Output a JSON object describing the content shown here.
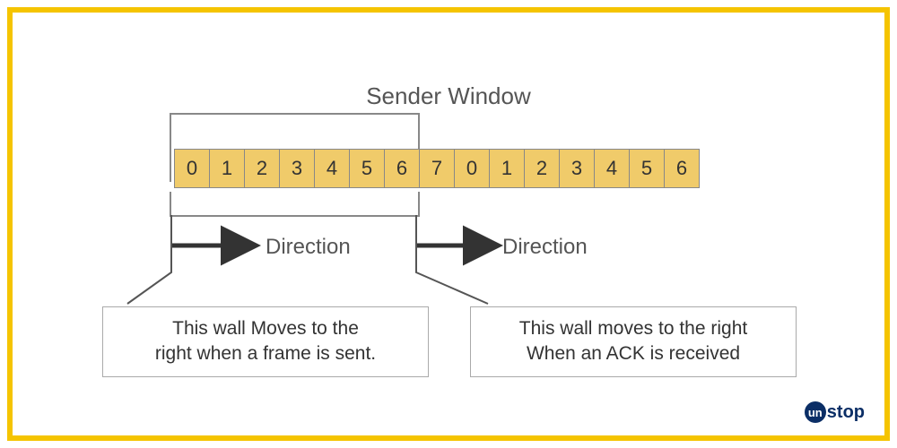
{
  "title": "Sender Window",
  "cells": [
    "0",
    "1",
    "2",
    "3",
    "4",
    "5",
    "6",
    "7",
    "0",
    "1",
    "2",
    "3",
    "4",
    "5",
    "6"
  ],
  "direction_label_1": "Direction",
  "direction_label_2": "Direction",
  "note_left_line1": "This wall Moves to the",
  "note_left_line2": "right when a frame is sent.",
  "note_right_line1": "This wall moves to the right",
  "note_right_line2": "When an ACK is received",
  "logo_badge": "un",
  "logo_text": "stop",
  "colors": {
    "accent": "#f5c400",
    "cell": "#f0cb6a",
    "ink": "#333",
    "logo": "#0b2e66"
  }
}
